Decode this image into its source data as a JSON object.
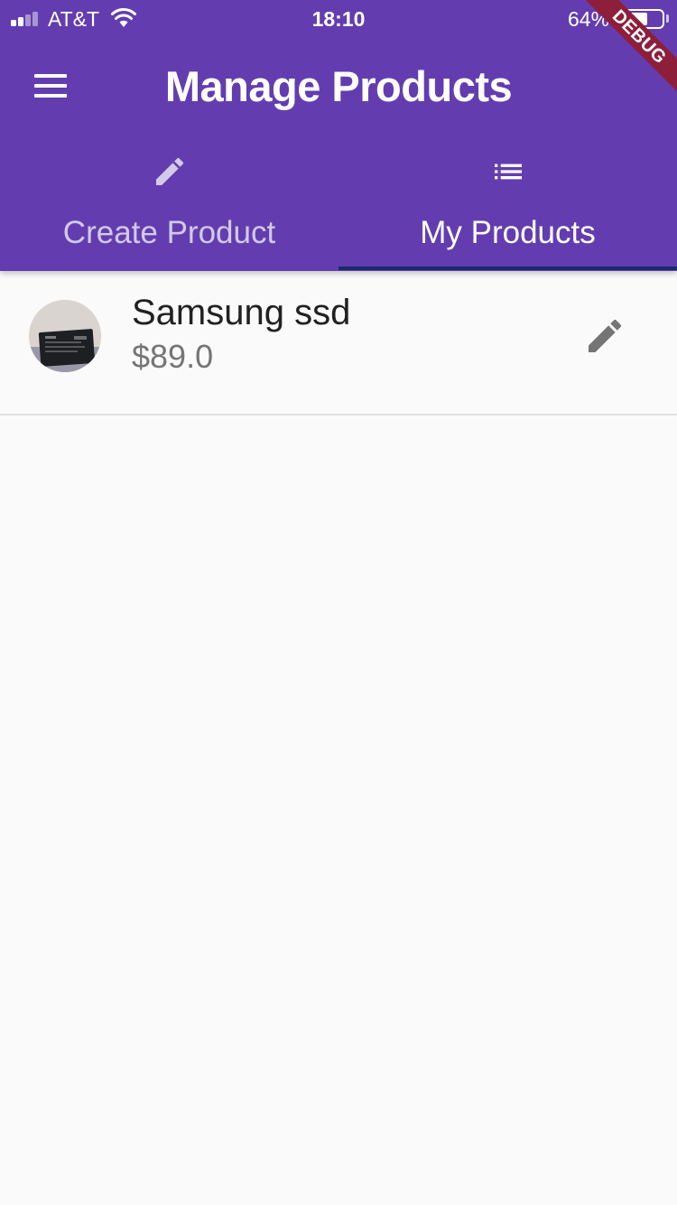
{
  "status_bar": {
    "carrier": "AT&T",
    "time": "18:10",
    "battery_percent": "64%",
    "battery_level": 0.64,
    "signal_bars": 2
  },
  "app_bar": {
    "title": "Manage Products"
  },
  "tabs": [
    {
      "label": "Create Product",
      "icon": "pencil-icon",
      "selected": false
    },
    {
      "label": "My Products",
      "icon": "list-icon",
      "selected": true
    }
  ],
  "debug_banner": "DEBUG",
  "products": [
    {
      "name": "Samsung ssd",
      "price": "$89.0",
      "thumbnail": "ssd-photo"
    }
  ],
  "colors": {
    "primary": "#633DB0",
    "tab_indicator": "#1b2a6b",
    "background": "#fafafa",
    "debug_ribbon": "#8e1f3a"
  }
}
